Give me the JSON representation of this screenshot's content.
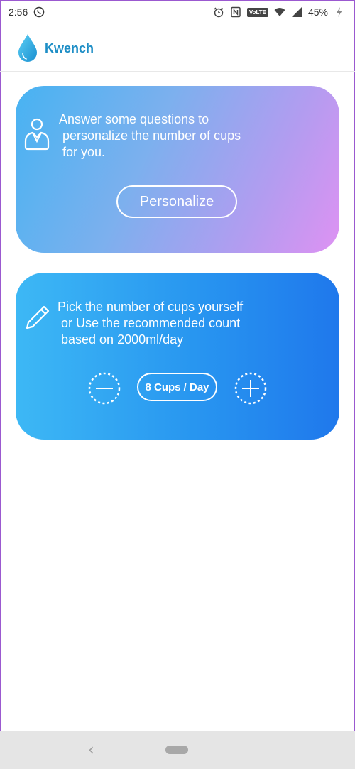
{
  "status_bar": {
    "time": "2:56",
    "battery": "45%",
    "volte": "VoLTE",
    "icons": [
      "whatsapp-icon",
      "alarm-icon",
      "nfc-icon",
      "volte-icon",
      "wifi-icon",
      "signal-icon",
      "battery-icon"
    ]
  },
  "header": {
    "app_name": "Kwench",
    "logo": "water-drop-icon",
    "accent": "#1e8ec6"
  },
  "personalize_card": {
    "icon": "person-icon",
    "text": "Answer some questions to\n personalize the number of cups\n for you.",
    "button_label": "Personalize",
    "gradient": [
      "#47b3f2",
      "#de92f2"
    ]
  },
  "pick_card": {
    "icon": "pencil-icon",
    "text": "Pick the number of cups yourself\n or Use the recommended count\n based on 2000ml/day",
    "cups_label": "8 Cups / Day",
    "minus_icon": "minus-icon",
    "plus_icon": "plus-icon",
    "gradient": [
      "#3db8f5",
      "#1f78ec"
    ]
  },
  "nav_bar": {
    "back_icon": "back-chevron-icon",
    "home_icon": "home-pill-icon",
    "back_glyph": "‹"
  }
}
